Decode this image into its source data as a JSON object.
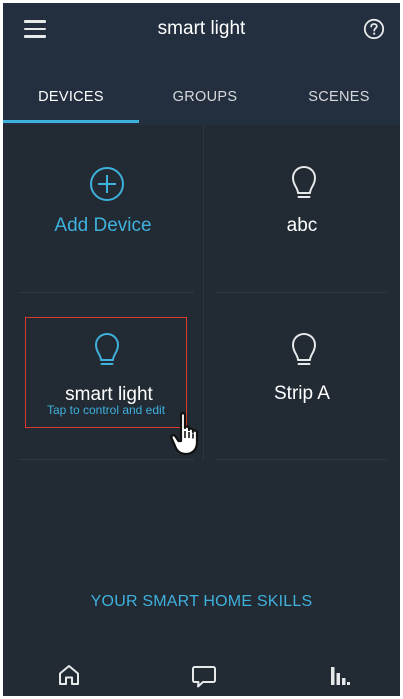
{
  "header": {
    "title": "smart light",
    "menu_icon": "hamburger-menu-icon",
    "help_icon": "help-circle-icon"
  },
  "tabs": [
    {
      "label": "DEVICES",
      "active": true
    },
    {
      "label": "GROUPS",
      "active": false
    },
    {
      "label": "SCENES",
      "active": false
    }
  ],
  "devices": {
    "add_device": {
      "label": "Add Device",
      "icon": "plus-circle-icon"
    },
    "items": [
      {
        "label": "abc",
        "icon": "light-bulb-icon"
      },
      {
        "label": "smart light",
        "icon": "light-bulb-icon",
        "hint": "Tap to control and edit",
        "highlighted": true
      },
      {
        "label": "Strip A",
        "icon": "light-bulb-icon"
      }
    ]
  },
  "skills_link": "YOUR SMART HOME SKILLS",
  "bottom_nav": [
    {
      "icon": "home-icon"
    },
    {
      "icon": "chat-bubble-icon"
    },
    {
      "icon": "equalizer-icon"
    }
  ],
  "colors": {
    "background": "#222a33",
    "header": "#232f3e",
    "accent": "#3fb1dd",
    "highlight_border": "#d83a2b"
  }
}
